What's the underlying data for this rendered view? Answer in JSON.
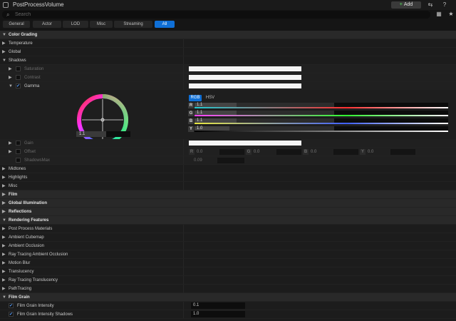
{
  "window": {
    "title": "PostProcessVolume",
    "add_label": "Add",
    "icons": [
      "panel-toggle-icon",
      "help-icon",
      "settings-icon",
      "star-icon"
    ]
  },
  "search": {
    "placeholder": "Search"
  },
  "tabs": [
    {
      "label": "General",
      "active": false
    },
    {
      "label": "Actor",
      "active": false
    },
    {
      "label": "LOD",
      "active": false
    },
    {
      "label": "Misc",
      "active": false
    },
    {
      "label": "Streaming",
      "active": false
    },
    {
      "label": "All",
      "active": true
    }
  ],
  "sections": {
    "color_grading": "Color Grading",
    "temperature": "Temperature",
    "global": "Global",
    "shadows": "Shadows",
    "saturation": "Saturation",
    "contrast": "Contrast",
    "gamma": "Gamma",
    "gain": "Gain",
    "offset": "Offset",
    "shadows_max": "ShadowsMax",
    "shadows_max_value": "0.09",
    "midtones": "Midtones",
    "highlights": "Highlights",
    "misc": "Misc",
    "film": "Film",
    "global_illumination": "Global Illumination",
    "reflections": "Reflections",
    "rendering_features": "Rendering Features",
    "post_process_materials": "Post Process Materials",
    "ambient_cubemap": "Ambient Cubemap",
    "ambient_occlusion": "Ambient Occlusion",
    "rt_ambient_occlusion": "Ray Tracing Ambient Occlusion",
    "motion_blur": "Motion Blur",
    "translucency": "Translucency",
    "rt_translucency": "Ray Tracing Translucency",
    "path_tracing": "PathTracing",
    "film_grain": "Film Grain",
    "film_grain_intensity": "Film Grain Intensity",
    "film_grain_intensity_value": "0.1",
    "film_grain_intensity_shadows": "Film Grain Intensity Shadows",
    "film_grain_intensity_shadows_value": "1.0"
  },
  "gamma_picker": {
    "wheel_value": "1.1",
    "wheel_fill": 0.55,
    "mode_rgb": "RGB",
    "mode_hsv": "HSV",
    "channels": [
      {
        "key": "R",
        "value": "1.1",
        "fill": 0.3,
        "color": "#ff4040"
      },
      {
        "key": "G",
        "value": "1.1",
        "fill": 0.3,
        "color": "#40ff40"
      },
      {
        "key": "B",
        "value": "1.1",
        "fill": 0.3,
        "color": "#4060ff"
      },
      {
        "key": "Y",
        "value": "1.0",
        "fill": 0.25,
        "color": "#ffff40"
      }
    ]
  },
  "offset_values": [
    {
      "key": "R",
      "value": "0.0"
    },
    {
      "key": "G",
      "value": "0.0"
    },
    {
      "key": "B",
      "value": "0.0"
    },
    {
      "key": "Y",
      "value": "0.0"
    }
  ],
  "colors": {
    "accent": "#0f6fd6",
    "checkbox": "#5aa0ff"
  }
}
